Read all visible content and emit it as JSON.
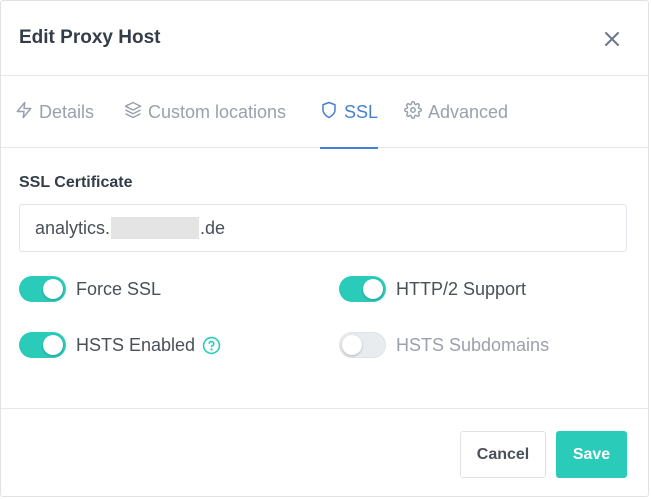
{
  "modal": {
    "title": "Edit Proxy Host",
    "close_icon": "close-icon"
  },
  "tabs": [
    {
      "label": "Details",
      "icon": "bolt-icon",
      "active": false
    },
    {
      "label": "Custom locations",
      "icon": "layers-icon",
      "active": false
    },
    {
      "label": "SSL",
      "icon": "shield-icon",
      "active": true
    },
    {
      "label": "Advanced",
      "icon": "gear-icon",
      "active": false
    }
  ],
  "ssl": {
    "certificate_label": "SSL Certificate",
    "certificate_value_prefix": "analytics.",
    "certificate_value_suffix": ".de",
    "options": [
      {
        "label": "Force SSL",
        "enabled": true
      },
      {
        "label": "HTTP/2 Support",
        "enabled": true
      },
      {
        "label": "HSTS Enabled",
        "enabled": true,
        "help_icon": "question-circle-icon"
      },
      {
        "label": "HSTS Subdomains",
        "enabled": false
      }
    ]
  },
  "footer": {
    "cancel_label": "Cancel",
    "save_label": "Save"
  },
  "colors": {
    "accent": "#2bcbba",
    "tab_active": "#467fcf"
  }
}
